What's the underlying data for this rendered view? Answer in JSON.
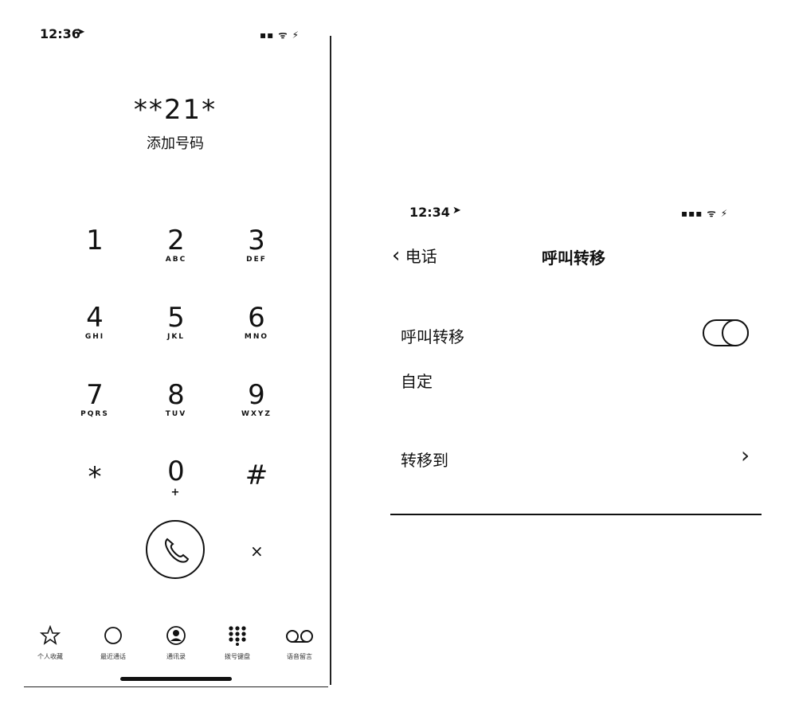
{
  "left": {
    "status": {
      "time": "12:36",
      "icons": "▪▪ ᯤ ⚡"
    },
    "dialed": "**21*",
    "add_number": "添加号码",
    "keys": [
      {
        "digit": "1",
        "letters": ""
      },
      {
        "digit": "2",
        "letters": "ABC"
      },
      {
        "digit": "3",
        "letters": "DEF"
      },
      {
        "digit": "4",
        "letters": "GHI"
      },
      {
        "digit": "5",
        "letters": "JKL"
      },
      {
        "digit": "6",
        "letters": "MNO"
      },
      {
        "digit": "7",
        "letters": "PQRS"
      },
      {
        "digit": "8",
        "letters": "TUV"
      },
      {
        "digit": "9",
        "letters": "WXYZ"
      },
      {
        "digit": "*",
        "letters": ""
      },
      {
        "digit": "0",
        "letters": "+"
      },
      {
        "digit": "#",
        "letters": ""
      }
    ],
    "delete_glyph": "×",
    "tabs": [
      {
        "icon": "star-icon",
        "label": "个人收藏"
      },
      {
        "icon": "clock-icon",
        "label": "最近通话"
      },
      {
        "icon": "person-icon",
        "label": "通讯录"
      },
      {
        "icon": "keypad-icon",
        "label": "拨号键盘"
      },
      {
        "icon": "voicemail-icon",
        "label": "语音留言"
      }
    ]
  },
  "right": {
    "status": {
      "time": "12:34",
      "icons": "▪▪▪ ᯤ ⚡"
    },
    "back_label": "电话",
    "title": "呼叫转移",
    "toggle_label": "呼叫转移",
    "toggle_on": true,
    "custom_label": "自定",
    "forward_to_label": "转移到",
    "chevron": "›"
  }
}
